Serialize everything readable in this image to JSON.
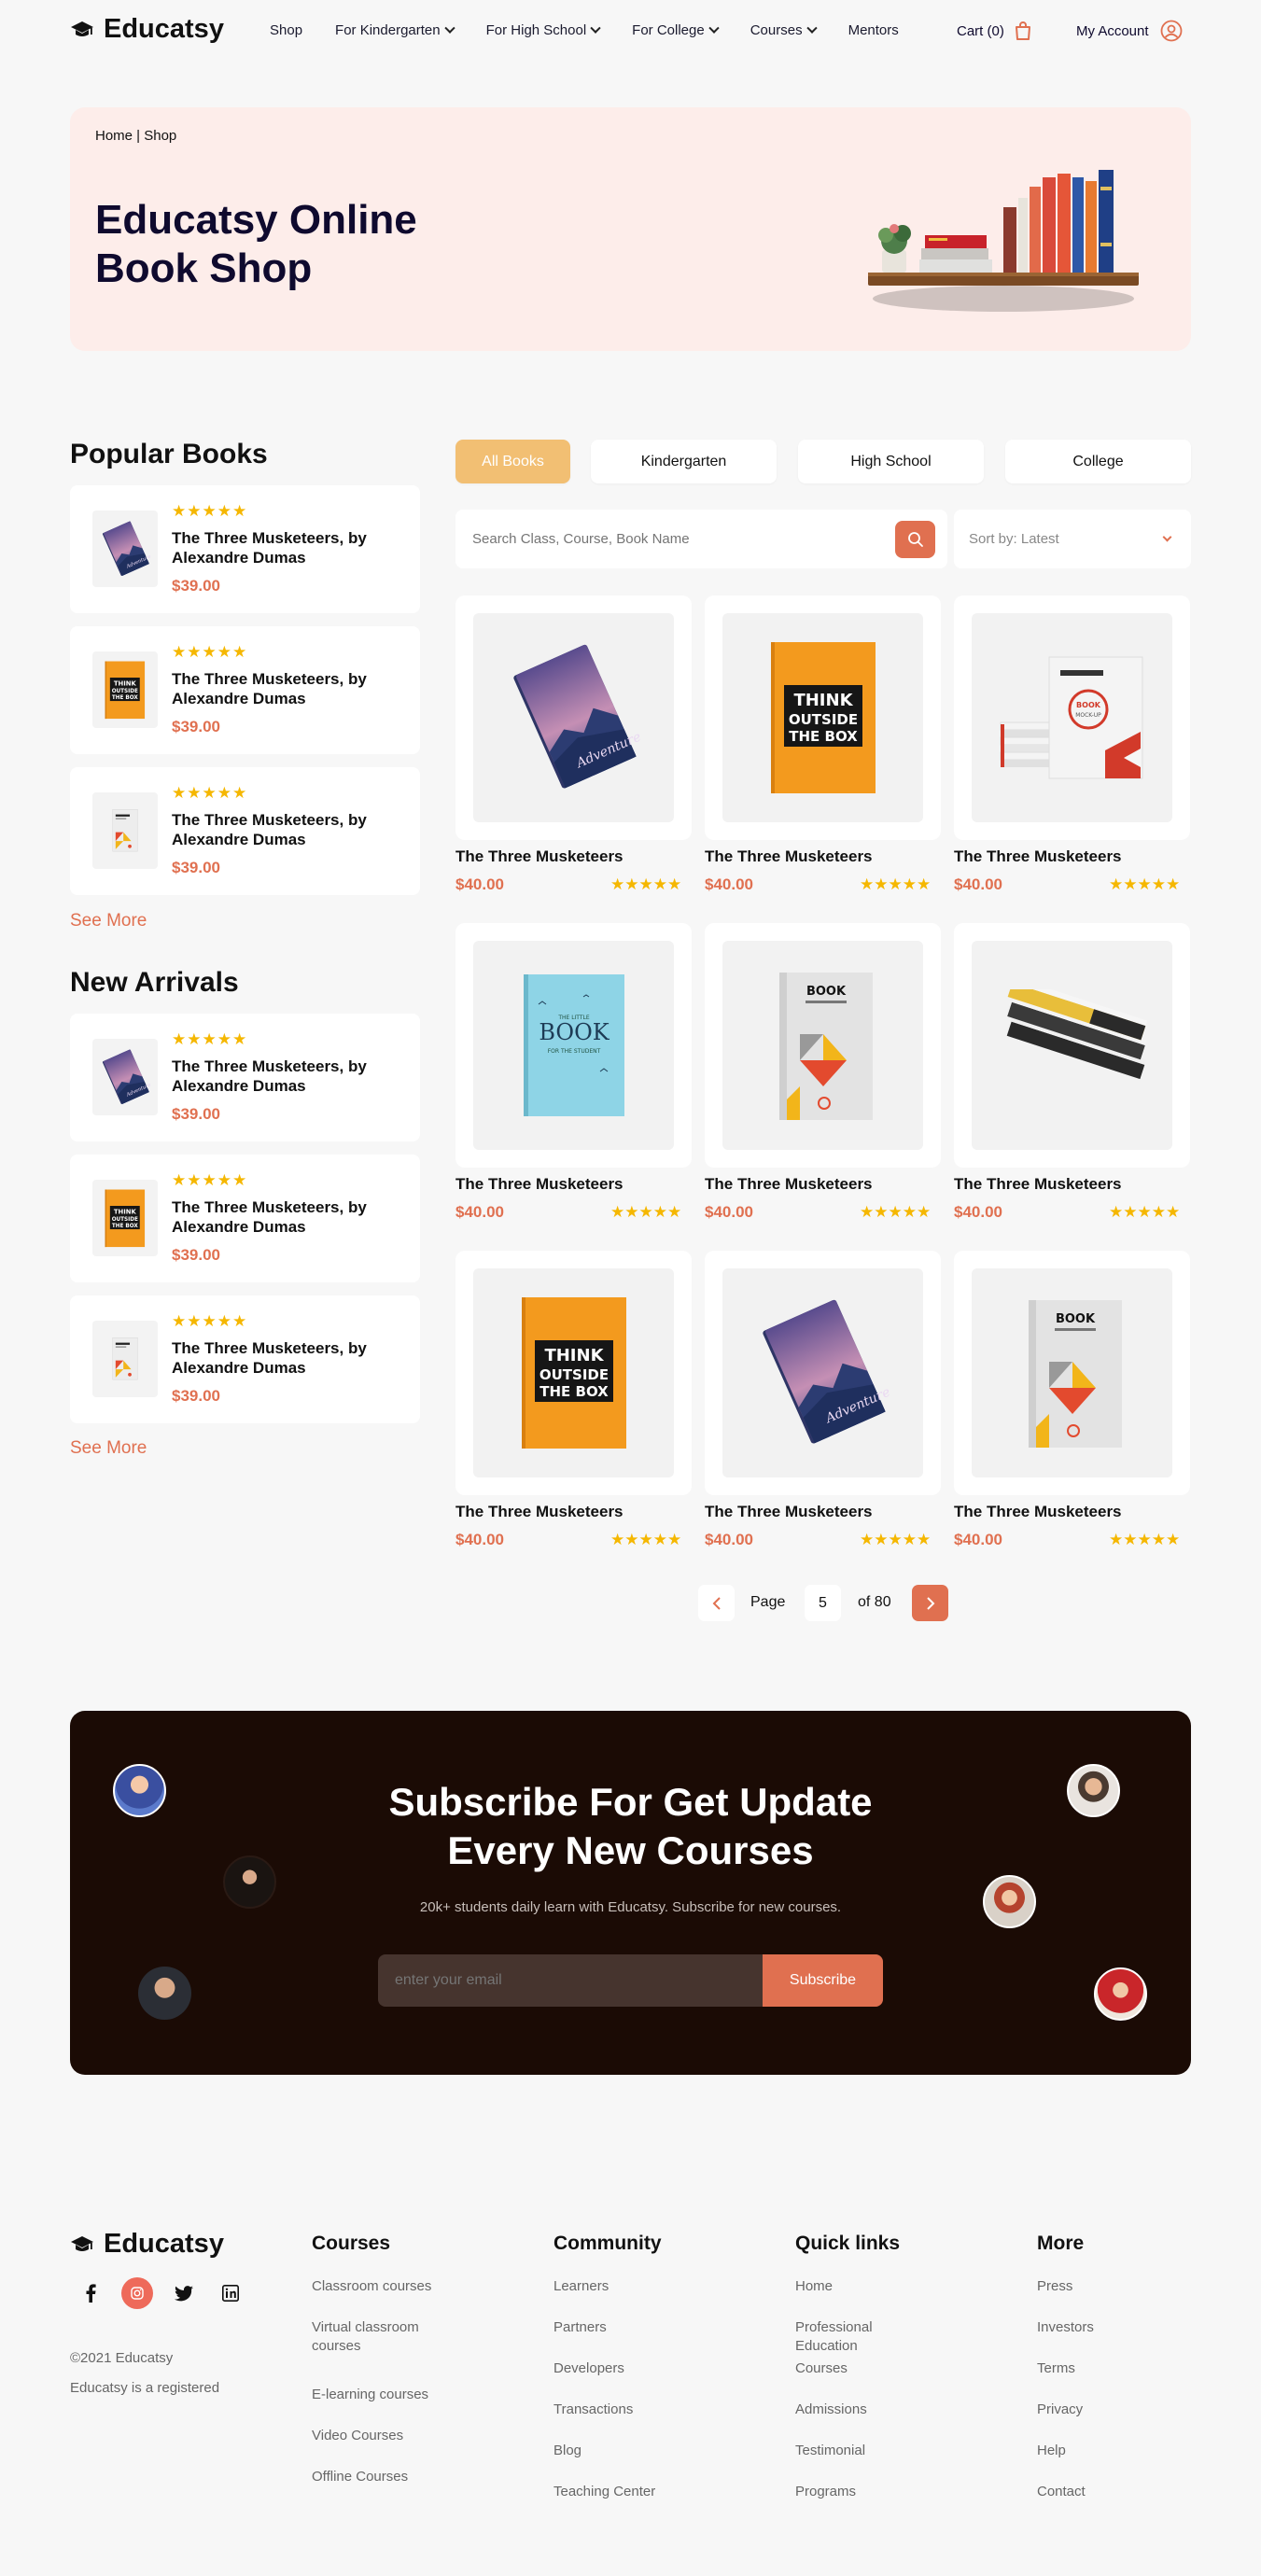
{
  "header": {
    "brand": "Educatsy",
    "nav": [
      "Shop",
      "For Kindergarten",
      "For High School",
      "For College",
      "Courses",
      "Mentors"
    ],
    "cart_label": "Cart (0)",
    "account_label": "My Account"
  },
  "hero": {
    "breadcrumb": "Home | Shop",
    "title_line1": "Educatsy Online",
    "title_line2": "Book Shop"
  },
  "sidebar": {
    "popular_heading": "Popular Books",
    "arrivals_heading": "New Arrivals",
    "see_more": "See More",
    "popular": [
      {
        "title": "The Three Musketeers, by Alexandre Dumas",
        "price": "$39.00",
        "rating": 5,
        "cover": "adventure"
      },
      {
        "title": "The Three Musketeers, by Alexandre Dumas",
        "price": "$39.00",
        "rating": 5,
        "cover": "think"
      },
      {
        "title": "The Three Musketeers, by Alexandre Dumas",
        "price": "$39.00",
        "rating": 5,
        "cover": "mockup"
      }
    ],
    "arrivals": [
      {
        "title": "The Three Musketeers, by Alexandre Dumas",
        "price": "$39.00",
        "rating": 5,
        "cover": "adventure"
      },
      {
        "title": "The Three Musketeers, by Alexandre Dumas",
        "price": "$39.00",
        "rating": 5,
        "cover": "think"
      },
      {
        "title": "The Three Musketeers, by Alexandre Dumas",
        "price": "$39.00",
        "rating": 5,
        "cover": "mockup"
      }
    ]
  },
  "filters": {
    "tabs": [
      "All Books",
      "Kindergarten",
      "High School",
      "College"
    ],
    "active_tab": "All Books",
    "search_placeholder": "Search Class, Course, Book Name",
    "sort_label": "Sort by: Latest"
  },
  "products": [
    {
      "title": "The Three Musketeers",
      "price": "$40.00",
      "rating": 5,
      "cover": "adventure"
    },
    {
      "title": "The Three Musketeers",
      "price": "$40.00",
      "rating": 5,
      "cover": "think"
    },
    {
      "title": "The Three Musketeers",
      "price": "$40.00",
      "rating": 5,
      "cover": "stack-mockup"
    },
    {
      "title": "The Three Musketeers",
      "price": "$40.00",
      "rating": 5,
      "cover": "blue-book"
    },
    {
      "title": "The Three Musketeers",
      "price": "$40.00",
      "rating": 5,
      "cover": "book-geo"
    },
    {
      "title": "The Three Musketeers",
      "price": "$40.00",
      "rating": 5,
      "cover": "book-pile"
    },
    {
      "title": "The Three Musketeers",
      "price": "$40.00",
      "rating": 5,
      "cover": "think"
    },
    {
      "title": "The Three Musketeers",
      "price": "$40.00",
      "rating": 5,
      "cover": "adventure"
    },
    {
      "title": "The Three Musketeers",
      "price": "$40.00",
      "rating": 5,
      "cover": "book-geo"
    }
  ],
  "pagination": {
    "page_label": "Page",
    "current": "5",
    "total_label": "of 80"
  },
  "subscribe": {
    "title_line1": "Subscribe For Get Update",
    "title_line2": "Every New Courses",
    "subtitle": "20k+ students daily learn with Educatsy. Subscribe for new courses.",
    "placeholder": "enter your email",
    "button": "Subscribe"
  },
  "footer": {
    "brand": "Educatsy",
    "copyright": "©2021 Educatsy",
    "registered": "Educatsy is a registered",
    "columns": [
      {
        "heading": "Courses",
        "links": [
          "Classroom courses",
          "Virtual classroom courses",
          "E-learning courses",
          "Video Courses",
          "Offline Courses"
        ]
      },
      {
        "heading": "Community",
        "links": [
          "Learners",
          "Partners",
          "Developers",
          "Transactions",
          "Blog",
          "Teaching Center"
        ]
      },
      {
        "heading": "Quick links",
        "links": [
          "Home",
          "Professional Education",
          "Courses",
          "Admissions",
          "Testimonial",
          "Programs"
        ]
      },
      {
        "heading": "More",
        "links": [
          "Press",
          "Investors",
          "Terms",
          "Privacy",
          "Help",
          "Contact"
        ]
      }
    ]
  },
  "colors": {
    "accent": "#E07050",
    "tab_active": "#F2BF73",
    "hero_bg": "#FDEDEA",
    "subscribe_bg": "#1B0B05",
    "star": "#F5B700",
    "text": "#0F0A2E"
  }
}
